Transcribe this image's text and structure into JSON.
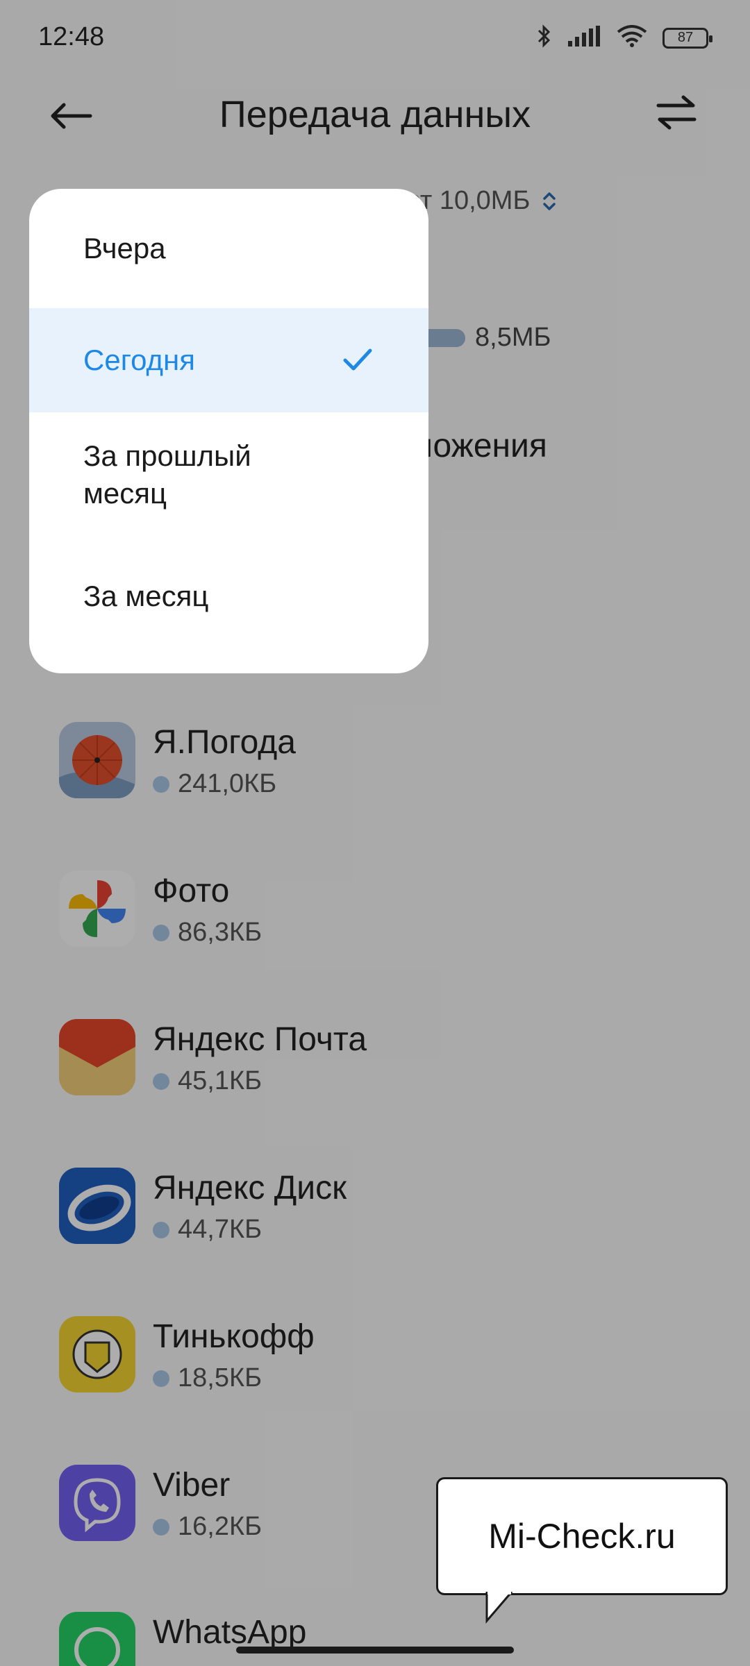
{
  "status_bar": {
    "time": "12:48",
    "battery": "87"
  },
  "header": {
    "title": "Передача данных"
  },
  "summary": {
    "text": "ет 10,0МБ"
  },
  "usage": {
    "value": "8,5МБ"
  },
  "section": {
    "title": "ложения"
  },
  "apps": [
    {
      "name": "Я.Погода",
      "size": "241,0КБ"
    },
    {
      "name": "Фото",
      "size": "86,3КБ"
    },
    {
      "name": "Яндекс Почта",
      "size": "45,1КБ"
    },
    {
      "name": "Яндекс Диск",
      "size": "44,7КБ"
    },
    {
      "name": "Тинькофф",
      "size": "18,5КБ"
    },
    {
      "name": "Viber",
      "size": "16,2КБ"
    },
    {
      "name": "WhatsApp",
      "size": ""
    }
  ],
  "menu": {
    "items": [
      {
        "label": "Вчера"
      },
      {
        "label": "Сегодня",
        "selected": true
      },
      {
        "label": "За прошлый месяц"
      },
      {
        "label": "За месяц"
      }
    ],
    "accent_color": "#1e88e5"
  },
  "watermark": {
    "text": "Mi-Check.ru"
  }
}
